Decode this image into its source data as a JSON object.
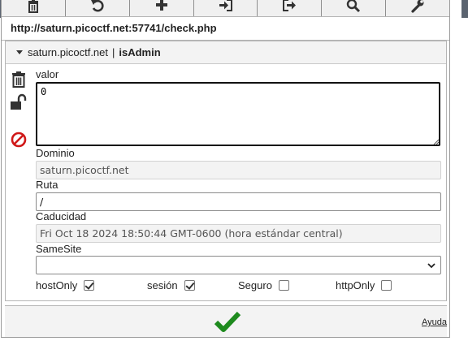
{
  "page_url": "http://saturn.picoctf.net:57741/check.php",
  "toolbar": {
    "buttons": [
      {
        "name": "delete-all",
        "icon": "trash-icon"
      },
      {
        "name": "reset",
        "icon": "undo-icon"
      },
      {
        "name": "add",
        "icon": "plus-icon"
      },
      {
        "name": "import",
        "icon": "import-icon"
      },
      {
        "name": "export",
        "icon": "export-icon"
      },
      {
        "name": "search",
        "icon": "search-icon"
      },
      {
        "name": "options",
        "icon": "wrench-icon"
      }
    ]
  },
  "cookie": {
    "domain_header": "saturn.picoctf.net",
    "separator": "|",
    "name": "isAdmin",
    "value_label": "valor",
    "value": "0",
    "domain_label": "Dominio",
    "domain": "saturn.picoctf.net",
    "path_label": "Ruta",
    "path": "/",
    "expiration_label": "Caducidad",
    "expiration": "Fri Oct 18 2024 18:50:44 GMT-0600 (hora estándar central)",
    "samesite_label": "SameSite",
    "samesite": "",
    "flags": {
      "hostonly_label": "hostOnly",
      "hostonly": true,
      "session_label": "sesión",
      "session": true,
      "secure_label": "Seguro",
      "secure": false,
      "httponly_label": "httpOnly",
      "httponly": false
    }
  },
  "side_icons": [
    "trash-icon",
    "unlock-icon",
    "block-icon"
  ],
  "footer": {
    "save_icon": "checkmark-icon",
    "help_label": "Ayuda"
  },
  "colors": {
    "save_green": "#1e8a1e",
    "block_red": "#d01818"
  }
}
